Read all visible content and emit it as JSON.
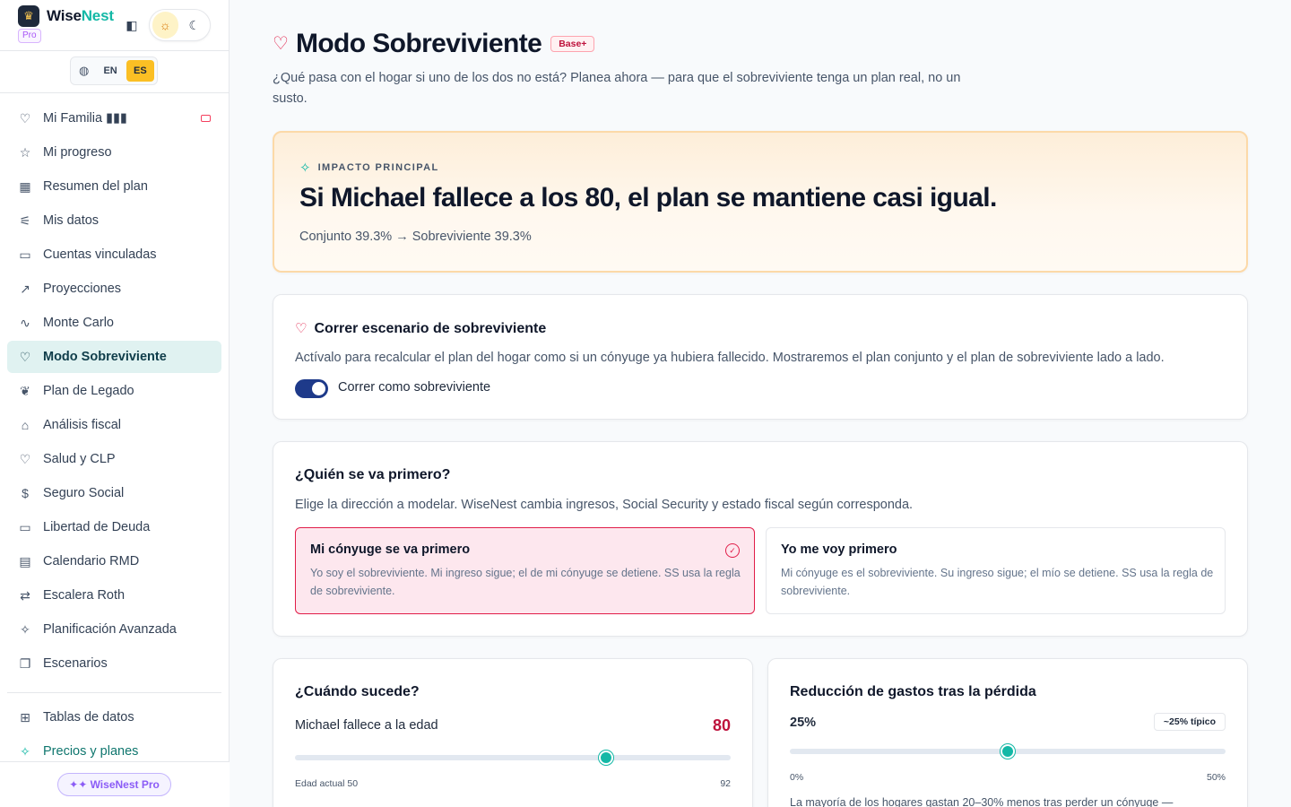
{
  "brand": {
    "name_main": "Wise",
    "name_accent": "Nest",
    "tier": "Pro"
  },
  "lang": {
    "en": "EN",
    "es": "ES"
  },
  "nav": {
    "items": [
      {
        "label": "Mi Familia ▮▮▮",
        "icon": "heart-icon"
      },
      {
        "label": "Mi progreso",
        "icon": "star-icon"
      },
      {
        "label": "Resumen del plan",
        "icon": "grid-icon"
      },
      {
        "label": "Mis datos",
        "icon": "sliders-icon"
      },
      {
        "label": "Cuentas vinculadas",
        "icon": "wallet-icon"
      },
      {
        "label": "Proyecciones",
        "icon": "trend-icon"
      },
      {
        "label": "Monte Carlo",
        "icon": "pulse-icon"
      },
      {
        "label": "Modo Sobreviviente",
        "icon": "heart-icon"
      },
      {
        "label": "Plan de Legado",
        "icon": "leaf-icon"
      },
      {
        "label": "Análisis fiscal",
        "icon": "bank-icon"
      },
      {
        "label": "Salud y CLP",
        "icon": "heart-pulse-icon"
      },
      {
        "label": "Seguro Social",
        "icon": "dollar-icon"
      },
      {
        "label": "Libertad de Deuda",
        "icon": "card-icon"
      },
      {
        "label": "Calendario RMD",
        "icon": "calendar-icon"
      },
      {
        "label": "Escalera Roth",
        "icon": "arrows-icon"
      },
      {
        "label": "Planificación Avanzada",
        "icon": "sparkles-icon"
      },
      {
        "label": "Escenarios",
        "icon": "copy-icon"
      }
    ],
    "secondary": [
      {
        "label": "Tablas de datos",
        "icon": "table-icon"
      },
      {
        "label": "Precios y planes",
        "icon": "sparkles-icon"
      }
    ],
    "pro_pill": "✦✦ WiseNest Pro"
  },
  "page": {
    "title": "Modo Sobreviviente",
    "badge": "Base+",
    "subtitle": "¿Qué pasa con el hogar si uno de los dos no está? Planea ahora — para que el sobreviviente tenga un plan real, no un susto."
  },
  "impact": {
    "label": "IMPACTO PRINCIPAL",
    "headline": "Si Michael fallece a los 80, el plan se mantiene casi igual.",
    "sub": "Conjunto 39.3% → Sobreviviente 39.3%"
  },
  "run": {
    "title": "Correr escenario de sobreviviente",
    "desc": "Actívalo para recalcular el plan del hogar como si un cónyuge ya hubiera fallecido. Mostraremos el plan conjunto y el plan de sobreviviente lado a lado.",
    "toggle_label": "Correr como sobreviviente",
    "toggle_on": true
  },
  "who": {
    "title": "¿Quién se va primero?",
    "desc": "Elige la dirección a modelar. WiseNest cambia ingresos, Social Security y estado fiscal según corresponda.",
    "options": [
      {
        "title": "Mi cónyuge se va primero",
        "desc": "Yo soy el sobreviviente. Mi ingreso sigue; el de mi cónyuge se detiene. SS usa la regla de sobreviviente.",
        "selected": true
      },
      {
        "title": "Yo me voy primero",
        "desc": "Mi cónyuge es el sobreviviente. Su ingreso sigue; el mío se detiene. SS usa la regla de sobreviviente.",
        "selected": false
      }
    ]
  },
  "when": {
    "title": "¿Cuándo sucede?",
    "field_label": "Michael fallece a la edad",
    "value": "80",
    "age": 80,
    "min_label": "Edad actual 50",
    "max_label": "92",
    "min": 50,
    "max": 92
  },
  "loss": {
    "title": "Reducción de gastos tras la pérdida",
    "value_label": "25%",
    "value": 25,
    "typical_badge": "~25% típico",
    "min_label": "0%",
    "max_label": "50%",
    "min": 0,
    "max": 50,
    "note": "La mayoría de los hogares gastan 20–30% menos tras perder un cónyuge —"
  },
  "colors": {
    "accent": "#14b8a6",
    "danger": "#e11d48",
    "toggle": "#1e3a8a",
    "lang_active": "#fbbf24"
  }
}
